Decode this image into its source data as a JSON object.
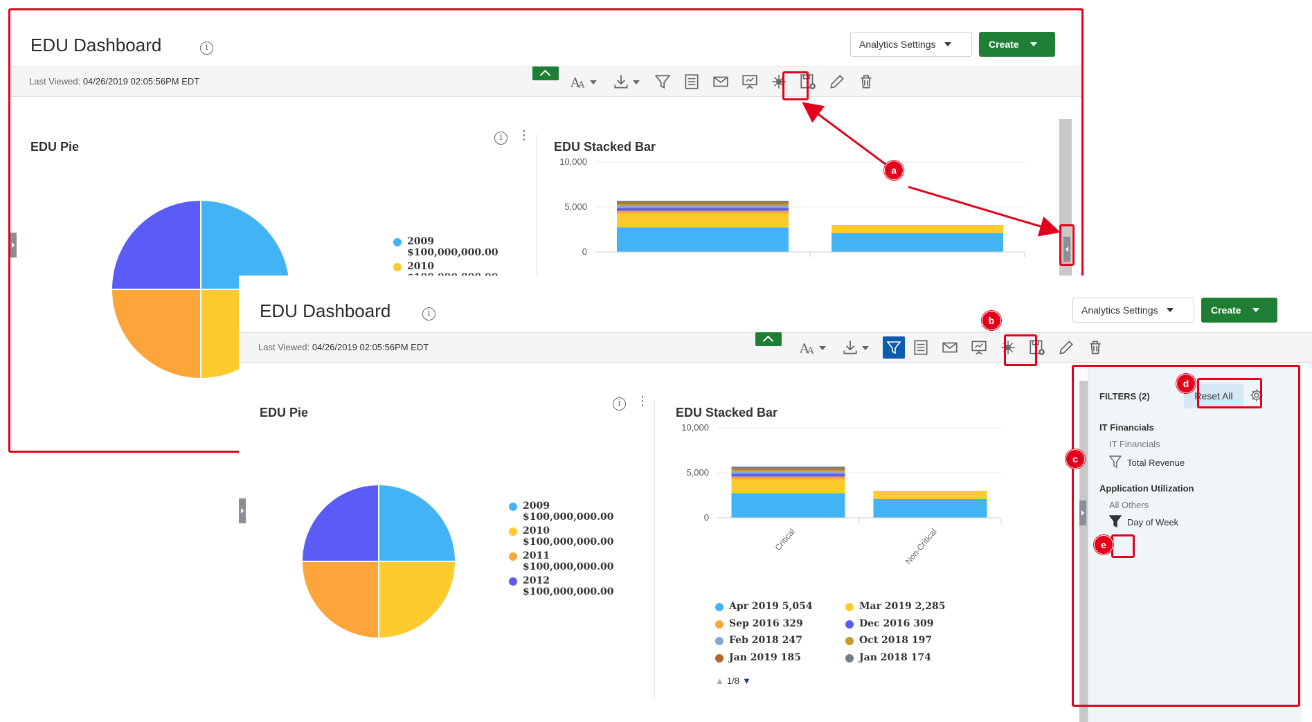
{
  "dashboard": {
    "title": "EDU Dashboard",
    "info_glyph": "i",
    "analytics_settings_label": "Analytics Settings",
    "create_label": "Create",
    "last_viewed_label": "Last Viewed:",
    "last_viewed_value": "04/26/2019 02:05:56PM EDT"
  },
  "toolbar_icons": [
    "font-size-icon",
    "download-icon",
    "filter-icon",
    "notes-icon",
    "email-icon",
    "presentation-icon",
    "layout-icon",
    "save-as-icon",
    "edit-icon",
    "delete-icon"
  ],
  "pie_widget": {
    "title": "EDU Pie",
    "legend": [
      {
        "label": "2009",
        "value": "$100,000,000.00",
        "color": "#42b4f5"
      },
      {
        "label": "2010",
        "value": "$100,000,000.00",
        "color": "#fecb2f"
      },
      {
        "label": "2011",
        "value": "$100,000,000.00",
        "color": "#fda53b"
      },
      {
        "label": "2012",
        "value": "$100,000,000.00",
        "color": "#5b5bf5"
      }
    ]
  },
  "bar_widget": {
    "title": "EDU Stacked Bar",
    "legend": [
      {
        "label": "Apr 2019 5,054",
        "color": "#42b4f5"
      },
      {
        "label": "Mar 2019 2,285",
        "color": "#fecb2f"
      },
      {
        "label": "Sep 2016 329",
        "color": "#fda53b"
      },
      {
        "label": "Dec 2016 309",
        "color": "#5b5bf5"
      },
      {
        "label": "Feb 2018 247",
        "color": "#8aa6d8"
      },
      {
        "label": "Oct 2018 197",
        "color": "#c49a2a"
      },
      {
        "label": "Jan 2019 185",
        "color": "#b5652a"
      },
      {
        "label": "Jan 2018 174",
        "color": "#6f7f8a"
      }
    ],
    "pager": "1/8"
  },
  "chart_data": [
    {
      "type": "pie",
      "title": "EDU Pie",
      "categories": [
        "2009",
        "2010",
        "2011",
        "2012"
      ],
      "values": [
        100000000,
        100000000,
        100000000,
        100000000
      ],
      "colors": [
        "#42b4f5",
        "#fecb2f",
        "#fda53b",
        "#5b5bf5"
      ]
    },
    {
      "type": "bar",
      "title": "EDU Stacked Bar",
      "categories": [
        "Critical",
        "Non-Critical"
      ],
      "ylim": [
        0,
        10000
      ],
      "yticks": [
        "10,000",
        "5,000",
        "0"
      ],
      "series": [
        {
          "name": "Apr 2019",
          "values": [
            2750,
            2100
          ],
          "color": "#42b4f5"
        },
        {
          "name": "Mar 2019",
          "values": [
            1500,
            900
          ],
          "color": "#fecb2f"
        },
        {
          "name": "Sep 2016",
          "values": [
            329,
            0
          ],
          "color": "#fda53b"
        },
        {
          "name": "Dec 2016",
          "values": [
            309,
            0
          ],
          "color": "#5b5bf5"
        },
        {
          "name": "Feb 2018",
          "values": [
            247,
            0
          ],
          "color": "#8aa6d8"
        },
        {
          "name": "Oct 2018",
          "values": [
            197,
            0
          ],
          "color": "#c49a2a"
        },
        {
          "name": "Jan 2019",
          "values": [
            185,
            0
          ],
          "color": "#b5652a"
        },
        {
          "name": "Jan 2018",
          "values": [
            174,
            0
          ],
          "color": "#6f7f8a"
        }
      ]
    }
  ],
  "filters_panel": {
    "header": "FILTERS (2)",
    "reset_label": "Reset All",
    "groups": [
      {
        "name": "IT Financials",
        "sub": "IT Financials",
        "item": "Total Revenue"
      },
      {
        "name": "Application Utilization",
        "sub": "All Others",
        "item": "Day of Week"
      }
    ]
  },
  "callouts": [
    "a",
    "b",
    "c",
    "d",
    "e"
  ],
  "annotation_color": "#e3001b"
}
